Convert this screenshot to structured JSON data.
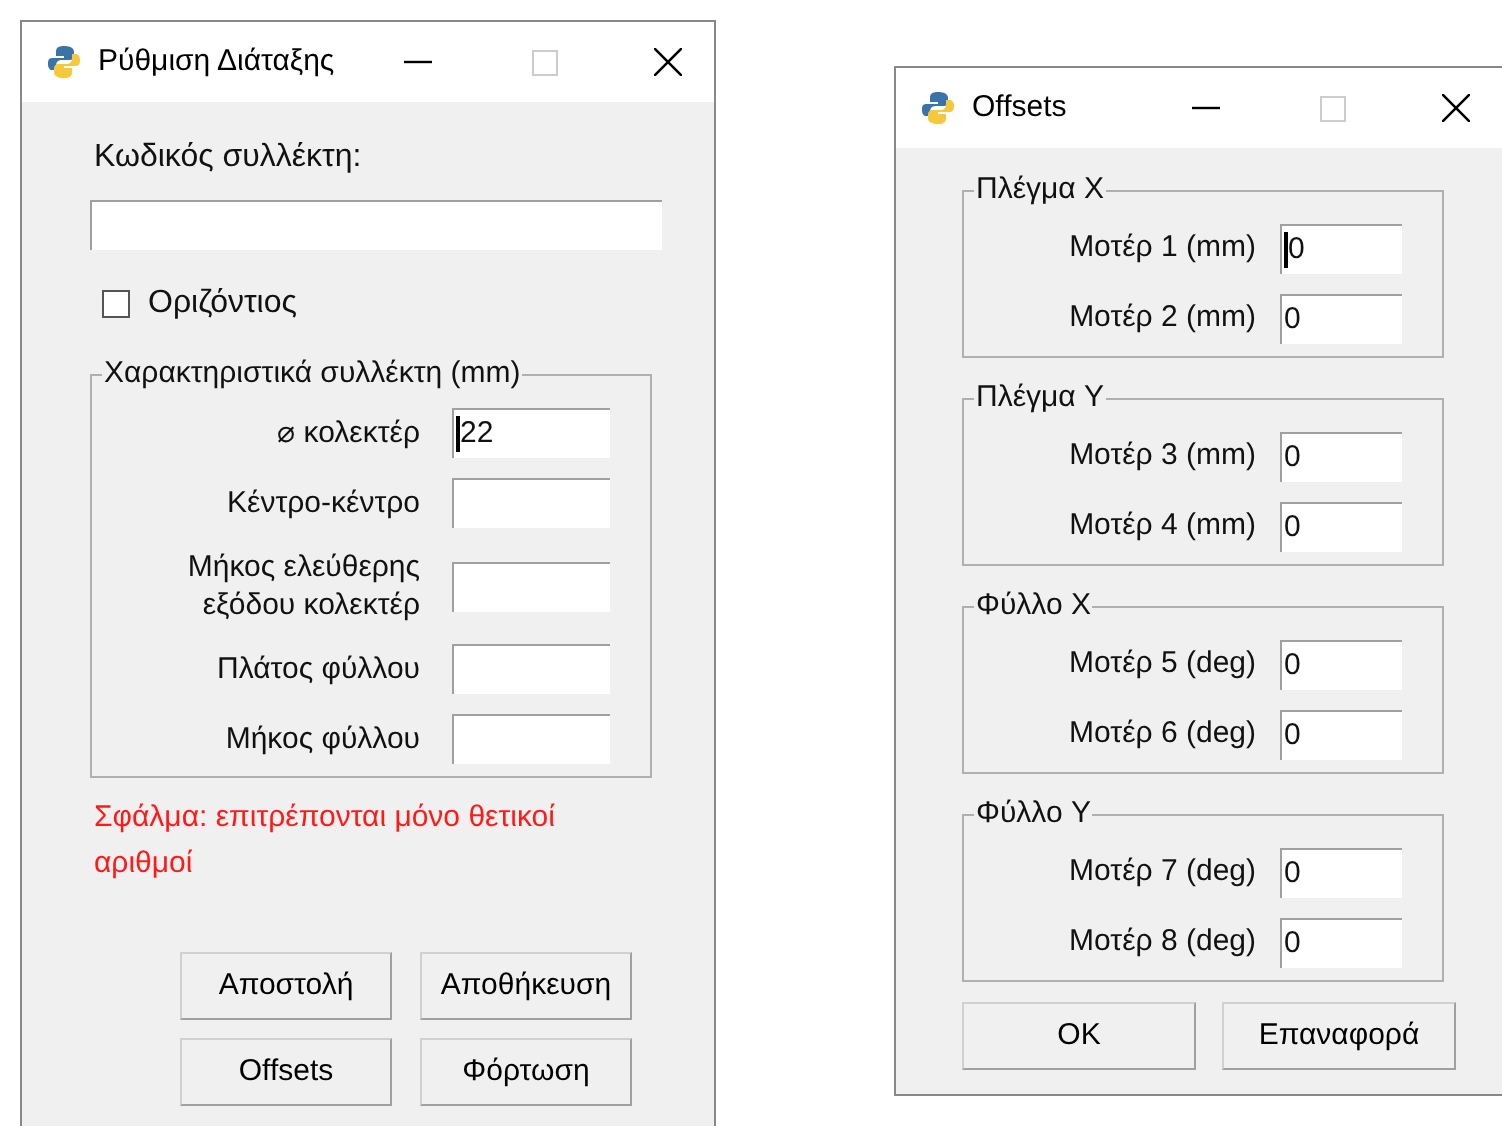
{
  "windows": [
    {
      "title": "Ρύθμιση Διάταξης",
      "code_label": "Κωδικός συλλέκτη:",
      "code_field": {
        "focused": false
      },
      "checkbox": {
        "label": "Οριζόντιος",
        "checked": false
      },
      "group": {
        "legend": "Χαρακτηριστικά συλλέκτη (mm)",
        "rows": [
          {
            "label": "⌀ κολεκτέρ",
            "value": "22",
            "focused": true
          },
          {
            "label": "Κέντρο-κέντρο",
            "focused": false
          },
          {
            "label": "Μήκος ελεύθερης εξόδου κολεκτέρ",
            "focused": false
          },
          {
            "label": "Πλάτος φύλλου",
            "focused": false
          },
          {
            "label": "Μήκος φύλλου",
            "focused": false
          }
        ]
      },
      "error": "Σφάλμα: επιτρέπονται μόνο θετικοί αριθμοί",
      "buttons": [
        "Αποστολή",
        "Αποθήκευση",
        "Offsets",
        "Φόρτωση"
      ]
    },
    {
      "title": "Offsets",
      "groups": [
        {
          "legend": "Πλέγμα X",
          "rows": [
            {
              "label": "Μοτέρ 1 (mm)",
              "value": "0",
              "focused": true
            },
            {
              "label": "Μοτέρ 2 (mm)",
              "value": "0",
              "focused": false
            }
          ]
        },
        {
          "legend": "Πλέγμα Y",
          "rows": [
            {
              "label": "Μοτέρ 3 (mm)",
              "value": "0",
              "focused": false
            },
            {
              "label": "Μοτέρ 4 (mm)",
              "value": "0",
              "focused": false
            }
          ]
        },
        {
          "legend": "Φύλλο X",
          "rows": [
            {
              "label": "Μοτέρ 5 (deg)",
              "value": "0",
              "focused": false
            },
            {
              "label": "Μοτέρ 6 (deg)",
              "value": "0",
              "focused": false
            }
          ]
        },
        {
          "legend": "Φύλλο Y",
          "rows": [
            {
              "label": "Μοτέρ 7 (deg)",
              "value": "0",
              "focused": false
            },
            {
              "label": "Μοτέρ 8 (deg)",
              "value": "0",
              "focused": false
            }
          ]
        }
      ],
      "buttons": [
        "OK",
        "Επαναφορά"
      ]
    }
  ]
}
